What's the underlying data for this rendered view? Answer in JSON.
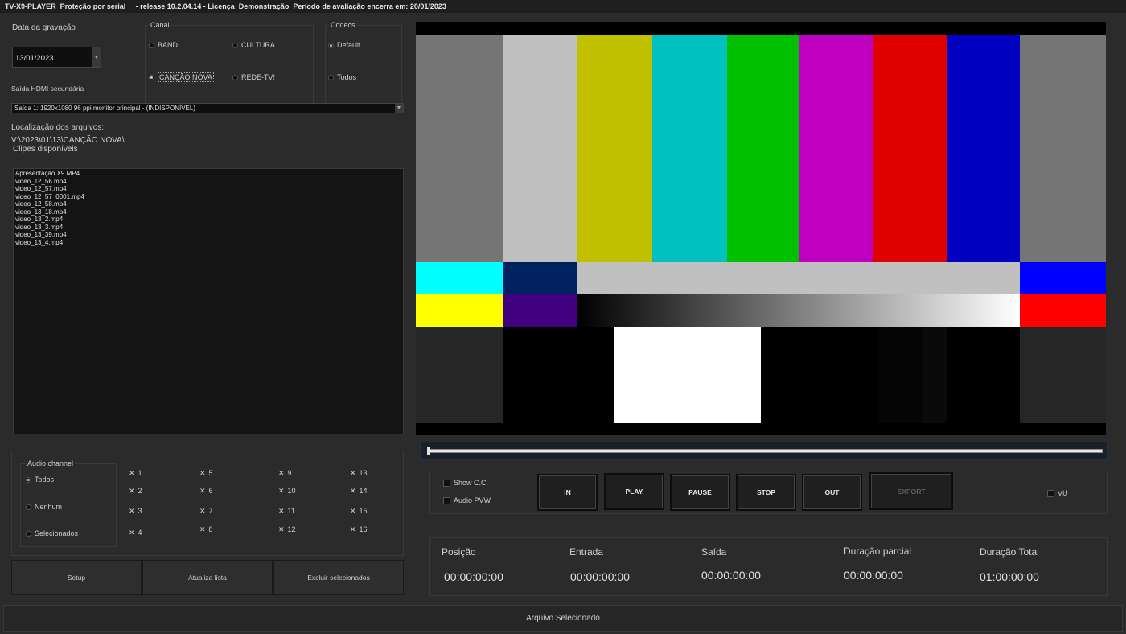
{
  "titlebar": {
    "text": "TV-X9-PLAYER  Proteção por serial     - release 10.2.04.14 - Licença  Demonstração  Período de avaliação encerra em: 20/01/2023"
  },
  "recording": {
    "date_label": "Data da gravação",
    "date_value": "13/01/2023"
  },
  "canal": {
    "title": "Canal",
    "options": [
      {
        "label": "BAND",
        "selected": false
      },
      {
        "label": "CULTURA",
        "selected": false
      },
      {
        "label": "CANÇÃO NOVA",
        "selected": true
      },
      {
        "label": "REDE-TV!",
        "selected": false
      }
    ]
  },
  "codecs": {
    "title": "Codecs",
    "options": [
      {
        "label": "Default",
        "selected": true
      },
      {
        "label": "Todos",
        "selected": false
      }
    ]
  },
  "hdmi": {
    "label": "Saída HDMI secundária",
    "value": "Saída 1: 1920x1080  96 ppi monitor principal - (INDISPONÍVEL)"
  },
  "location": {
    "label": "Localização dos arquivos:",
    "path": "V:\\2023\\01\\13\\CANÇÃO NOVA\\"
  },
  "clips": {
    "label": "Clipes disponíveis",
    "items": [
      "Apresentação X9.MP4",
      "video_12_56.mp4",
      "video_12_57.mp4",
      "video_12_57_0001.mp4",
      "video_12_58.mp4",
      "video_13_18.mp4",
      "video_13_2.mp4",
      "video_13_3.mp4",
      "video_13_39.mp4",
      "video_13_4.mp4"
    ]
  },
  "audio": {
    "title": "Audio channel",
    "modes": [
      {
        "label": "Todos",
        "selected": true
      },
      {
        "label": "Nenhum",
        "selected": false
      },
      {
        "label": "Selecionados",
        "selected": false
      }
    ],
    "channels": [
      "1",
      "2",
      "3",
      "4",
      "5",
      "6",
      "7",
      "8",
      "9",
      "10",
      "11",
      "12",
      "13",
      "14",
      "15",
      "16"
    ]
  },
  "bottom_buttons": {
    "setup": "Setup",
    "refresh": "Atualiza lista",
    "delete": "Excluir selecionados"
  },
  "options": {
    "show_cc": "Show C.C.",
    "audio_pvw": "Audio PVW",
    "vu": "VU"
  },
  "transport": {
    "in": "iN",
    "play": "PLAY",
    "pause": "PAUSE",
    "stop": "STOP",
    "out": "OUT",
    "export": "EXPORT"
  },
  "times": {
    "position": {
      "label": "Posição",
      "value": "00:00:00:00"
    },
    "entry": {
      "label": "Entrada",
      "value": "00:00:00:00"
    },
    "exit": {
      "label": "Saída",
      "value": "00:00:00:00"
    },
    "partial": {
      "label": "Duração parcial",
      "value": "00:00:00:00"
    },
    "total": {
      "label": "Duração Total",
      "value": "01:00:00:00"
    }
  },
  "status": {
    "text": "Arquivo Selecionado"
  },
  "colors": {
    "gray": "#757575",
    "white": "#c0c0c0",
    "yellow": "#c0c000",
    "cyan": "#00c0c0",
    "green": "#00c000",
    "magenta": "#c000c0",
    "red": "#e00000",
    "blue": "#0000c0"
  }
}
